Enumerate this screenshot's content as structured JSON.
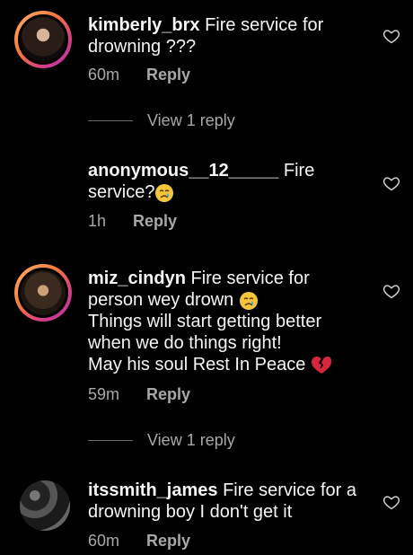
{
  "comments": [
    {
      "username": "kimberly_brx",
      "text": " Fire service for drowning ???",
      "time": "60m",
      "reply_label": "Reply",
      "view_replies": "View 1 reply"
    },
    {
      "username": "anonymous__12_____",
      "text": " Fire service?",
      "time": "1h",
      "reply_label": "Reply"
    },
    {
      "username": "miz_cindyn",
      "text_line1": " Fire service for",
      "text_line2": "person wey drown",
      "text_line3": "Things will start getting better",
      "text_line4": "when we do things right!",
      "text_line5": "May his soul Rest In Peace",
      "time": "59m",
      "reply_label": "Reply",
      "view_replies": "View 1 reply"
    },
    {
      "username": "itssmith_james",
      "text": " Fire service for a drowning boy I don't get it",
      "time": "60m",
      "reply_label": "Reply"
    }
  ],
  "icons": {
    "like": "heart-outline-icon",
    "crying": "crying-face-icon",
    "broken_heart": "broken-heart-icon"
  },
  "colors": {
    "background": "#000000",
    "text": "#f5f5f5",
    "muted": "#a8a8a8",
    "story_ring": "#d23a8a"
  }
}
